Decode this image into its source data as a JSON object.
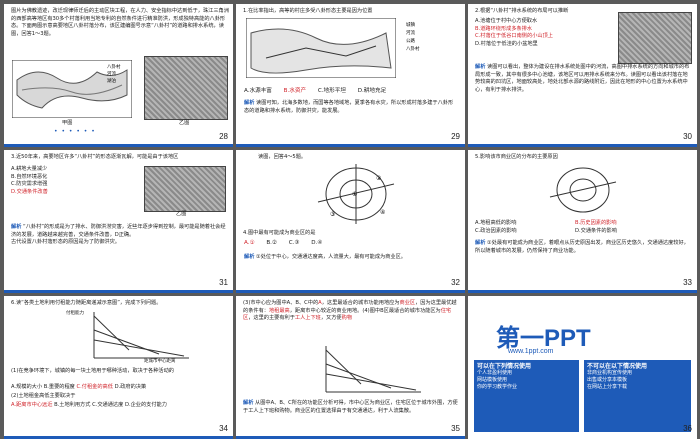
{
  "slides": [
    {
      "num": "28",
      "text": "图片为佛教遗迹，改迁现律师迁后的主动区块工程，在人力、安全指标中达到低于，珠江三角洲的西部高等地区有30多个村落利用当地专利的自然条件进行精准防洪，形成独特高能的八卦形态。下面两图示意高要地区八卦村落分布，该区建编图号示意“八卦村”的道路和排水系统，读图，回答1～3题。",
      "legend": [
        "八卦村",
        "河流",
        "湖泊"
      ],
      "caption_a": "甲图",
      "caption_b": "乙图",
      "dots": "• • • • • •"
    },
    {
      "num": "29",
      "q": "1.在比率指出，高等的村庄多受八卦形态主要是因为位置",
      "answers": [
        "A.水源丰富",
        "B.水资产",
        "C.地形平坦",
        "D.耕地充足"
      ],
      "analysis_label": "解析",
      "analysis": "读图可知，北海多数地，而国等各地域地，夏季各有水灾，所以形成村落多建于八卦形态的道路和排水系统，防御洪灾，能发展。",
      "legend": [
        "城镇",
        "河流",
        "公路",
        "八卦村"
      ]
    },
    {
      "num": "30",
      "q": "2.根据“八卦村”排水系统的布局可以推断",
      "options": [
        "A.池塘位于村中心方便取水",
        "B.道路环绕形成多条排水",
        "C.村落位于低谷口南侧的小山顶上",
        "D.村落位于低洼的小盆地里"
      ],
      "analysis_label": "解析",
      "analysis": "读图可以看出，整体为建设在排水系统处图中的河流，高图中排水系统的方向和城市的布局形成一致，其中有很多中心池塘，该地区可以用排水系统来分布。读图可以看出该村落在地势较高的凹坑区，地面较高处，地处北部水源的路线附近，因此在地形的中心位置为水系统中心，有利于排水排洪。"
    },
    {
      "num": "31",
      "q": "3.近50年来，高要地区许多“八卦村”的形态逐渐瓦解，可能是由于该地区",
      "options": [
        "A.耕地大量减少",
        "B.自然环境恶化",
        "C.防灾需求增强",
        "D.交通条件改善"
      ],
      "caption": "乙图",
      "analysis_label": "解析",
      "analysis": "“八卦村”的形成是为了排水、防御洪涝灾害，近些年逐步得到控制，最可能是随着社会经济的发展，道路越来越完善，交通条件改善，D正确。",
      "analysis2": "古代设置八卦村落形态的原因是为了防御洪灾。"
    },
    {
      "num": "32",
      "q": "读图，回答4～5题。",
      "q4": "4.图中最有可能成为商业区的是",
      "answers": [
        "A.①",
        "B.②",
        "C.③",
        "D.④"
      ],
      "analysis_label": "解析",
      "analysis": "①处位于中心，交通通达度高，人流量大，最有可能成为商业区。"
    },
    {
      "num": "33",
      "q": "5.影响该市商业区的分布的主要原因",
      "options": [
        "A.地租高低的影响",
        "B.历史因素的影响",
        "C.政治因素的影响",
        "D.交通条件的影响"
      ],
      "analysis_label": "解析",
      "analysis": "①处最有可能成为商业区，着眼点从历史原因出发，商业区历史悠久，交通通达度较好，所以随着城市的发展，仍然保持了商业功能。"
    },
    {
      "num": "34",
      "q": "6.读“各类土地利用付租能力随距离递减示意图”，完成下列问题。",
      "graph_labels": [
        "付租能力",
        "距城市中心距离",
        "商业",
        "住宅",
        "工业"
      ],
      "q6a": "(1)在竞争环境下，城镇的每一块土地用于哪种活动，取决于各种活动的",
      "options_a": [
        "A.规模的大小",
        "B.重要的程度",
        "C.付租金的高低",
        "D.政府的决策"
      ],
      "q6b": "(2)土地租金高低主要取决于",
      "options_b": [
        "A.距离市中心远近",
        "B.土地利用方式",
        "C.交通通达度",
        "D.企业的支付能力"
      ]
    },
    {
      "num": "35",
      "q": "(3)市中心应为图中A、B、C中的",
      "fill1": "A",
      "q_mid": "，这里最适合的城市功能用地应为",
      "fill2": "商业区",
      "q_end": "，因为这里最优越的条件有：",
      "fill3": "地租最高",
      "q_end2": "，距离市中心较近的商业用地。(4)图中B区最适合的城市功能区为",
      "fill4": "住宅区",
      "q_end3": "，这里的主要有利于",
      "fill5": "工人上下班",
      "q_end4": "，又方便",
      "fill6": "购物",
      "analysis_label": "解析",
      "analysis": "从图中A、B、C所在的功能区分析可得，市中心区为商业区，住宅区位于城市外围，方便于工人上下班和购物。商业区的位置选择由于有交通通达，利于人流集散。"
    },
    {
      "num": "36",
      "logo": "第一PPT",
      "url": "www.1ppt.com",
      "panel_left_title": "可以在下列情况使用",
      "panel_right_title": "不可以在以下情况使用",
      "panel_left_items": [
        "个人非盈利使用",
        "网站模板使用",
        "你的学习教学作业"
      ],
      "panel_right_items": [
        "非商业机构宣传使用",
        "出售或分享本模板",
        "在网站上分享下载"
      ]
    }
  ]
}
